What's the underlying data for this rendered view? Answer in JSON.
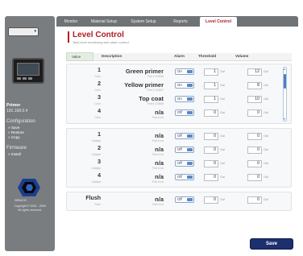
{
  "sidebar": {
    "language": "",
    "device_name": "Primer",
    "device_ip": "192.168.0.4",
    "configuration_title": "Configuration",
    "configuration_links": [
      "» Save",
      "» Restore",
      "» Copy"
    ],
    "firmware_title": "Firmware",
    "firmware_links": [
      "» Install"
    ],
    "logo_text": "GRACO",
    "copyright": [
      "Copyright © 2004 - 2009",
      "All rights reserved."
    ]
  },
  "tabs": [
    {
      "label": "Monitor",
      "active": false
    },
    {
      "label": "Material Setup",
      "active": false
    },
    {
      "label": "System Setup",
      "active": false
    },
    {
      "label": "Reports",
      "active": false
    },
    {
      "label": "Level Control",
      "active": true
    }
  ],
  "header": {
    "title": "Level Control",
    "subtitle": "Tank level monitoring and alarm control"
  },
  "columns": {
    "value": "Valve",
    "description": "Description",
    "alarm": "Alarm",
    "threshold": "Threshold",
    "volume": "Volume"
  },
  "colors": {
    "accent": "#b01e23",
    "save": "#1c2f6e",
    "toggle": "#5b88c4"
  },
  "groups": [
    {
      "rows": [
        {
          "num": "1",
          "sub": "Color",
          "desc": "Green primer",
          "desc_sub": "Part # 123456",
          "alarm": "On",
          "threshold": "1",
          "volume": "12"
        },
        {
          "num": "2",
          "sub": "Color",
          "desc": "Yellow primer",
          "desc_sub": "Part # 123457",
          "alarm": "On",
          "threshold": "1",
          "volume": "8"
        },
        {
          "num": "3",
          "sub": "Color",
          "desc": "Top coat",
          "desc_sub": "Part # 123458",
          "alarm": "On",
          "threshold": "1",
          "volume": "10"
        },
        {
          "num": "4",
          "sub": "Color",
          "desc": "n/a",
          "desc_sub": "Part # n/a",
          "alarm": "Off",
          "threshold": "0",
          "volume": "0"
        }
      ]
    },
    {
      "rows": [
        {
          "num": "1",
          "sub": "Catalyst",
          "desc": "n/a",
          "desc_sub": "Part # n/a",
          "alarm": "Off",
          "threshold": "0",
          "volume": "0"
        },
        {
          "num": "2",
          "sub": "Catalyst",
          "desc": "n/a",
          "desc_sub": "Part # n/a",
          "alarm": "Off",
          "threshold": "0",
          "volume": "0"
        },
        {
          "num": "3",
          "sub": "Catalyst",
          "desc": "n/a",
          "desc_sub": "Part # n/a",
          "alarm": "Off",
          "threshold": "0",
          "volume": "0"
        },
        {
          "num": "4",
          "sub": "Catalyst",
          "desc": "n/a",
          "desc_sub": "Part # n/a",
          "alarm": "Off",
          "threshold": "0",
          "volume": "0"
        }
      ]
    },
    {
      "rows": [
        {
          "num": "Flush",
          "sub": "Flush",
          "desc": "n/a",
          "desc_sub": "Part # n/a",
          "alarm": "Off",
          "threshold": "0",
          "volume": "0"
        }
      ]
    }
  ],
  "unit_label": "Gal",
  "save_label": "Save"
}
